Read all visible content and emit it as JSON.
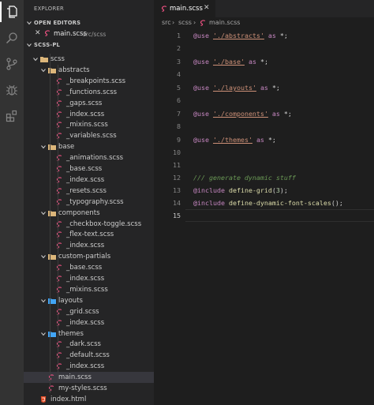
{
  "activity_bar": {
    "icons": [
      "explorer-icon",
      "search-icon",
      "source-control-icon",
      "debug-icon",
      "extensions-icon"
    ]
  },
  "explorer": {
    "title": "EXPLORER",
    "open_editors_label": "OPEN EDITORS",
    "open_editor": {
      "close": "✕",
      "name": "main.scss",
      "path": "src/scss"
    },
    "workspace_label": "SCSS-PL",
    "tree": [
      {
        "type": "folder",
        "name": "scss"
      },
      {
        "type": "folder",
        "name": "abstracts"
      },
      {
        "type": "file",
        "name": "_breakpoints.scss"
      },
      {
        "type": "file",
        "name": "_functions.scss"
      },
      {
        "type": "file",
        "name": "_gaps.scss"
      },
      {
        "type": "file",
        "name": "_index.scss"
      },
      {
        "type": "file",
        "name": "_mixins.scss"
      },
      {
        "type": "file",
        "name": "_variables.scss"
      },
      {
        "type": "folder",
        "name": "base"
      },
      {
        "type": "file",
        "name": "_animations.scss"
      },
      {
        "type": "file",
        "name": "_base.scss"
      },
      {
        "type": "file",
        "name": "_index.scss"
      },
      {
        "type": "file",
        "name": "_resets.scss"
      },
      {
        "type": "file",
        "name": "_typography.scss"
      },
      {
        "type": "folder",
        "name": "components"
      },
      {
        "type": "file",
        "name": "_checkbox-toggle.scss"
      },
      {
        "type": "file",
        "name": "_flex-text.scss"
      },
      {
        "type": "file",
        "name": "_index.scss"
      },
      {
        "type": "folder",
        "name": "custom-partials"
      },
      {
        "type": "file",
        "name": "_base.scss"
      },
      {
        "type": "file",
        "name": "_index.scss"
      },
      {
        "type": "file",
        "name": "_mixins.scss"
      },
      {
        "type": "folder",
        "name": "layouts"
      },
      {
        "type": "file",
        "name": "_grid.scss"
      },
      {
        "type": "file",
        "name": "_index.scss"
      },
      {
        "type": "folder",
        "name": "themes"
      },
      {
        "type": "file",
        "name": "_dark.scss"
      },
      {
        "type": "file",
        "name": "_default.scss"
      },
      {
        "type": "file",
        "name": "_index.scss"
      },
      {
        "type": "file",
        "name": "main.scss"
      },
      {
        "type": "file",
        "name": "my-styles.scss"
      },
      {
        "type": "html",
        "name": "index.html"
      }
    ]
  },
  "editor": {
    "tab": {
      "name": "main.scss",
      "close": "✕"
    },
    "breadcrumb": [
      "src",
      "scss",
      "main.scss"
    ],
    "breadcrumb_sep": "›",
    "line_numbers": [
      "1",
      "2",
      "3",
      "4",
      "5",
      "6",
      "7",
      "8",
      "9",
      "10",
      "11",
      "12",
      "13",
      "14",
      "15"
    ],
    "lines": {
      "l1": {
        "kw": "@use",
        "str": "'./abstracts'",
        "as": "as",
        "rest": "*;"
      },
      "l3": {
        "kw": "@use",
        "str": "'./base'",
        "as": "as",
        "rest": "*;"
      },
      "l5": {
        "kw": "@use",
        "str": "'./layouts'",
        "as": "as",
        "rest": "*;"
      },
      "l7": {
        "kw": "@use",
        "str": "'./components'",
        "as": "as",
        "rest": "*;"
      },
      "l9": {
        "kw": "@use",
        "str": "'./themes'",
        "as": "as",
        "rest": "*;"
      },
      "l12": {
        "comment": "/// generate dynamic stuff"
      },
      "l13": {
        "kw": "@include",
        "fn": "define-grid",
        "open": "(",
        "num": "3",
        "close": ");"
      },
      "l14": {
        "kw": "@include",
        "fn": "define-dynamic-font-scales",
        "close": "();"
      }
    }
  },
  "colors": {
    "sass_icon": "#f55385",
    "folder_icon": "#dcb67a",
    "folder_blue": "#42a5f5",
    "html_icon": "#e44d26"
  }
}
